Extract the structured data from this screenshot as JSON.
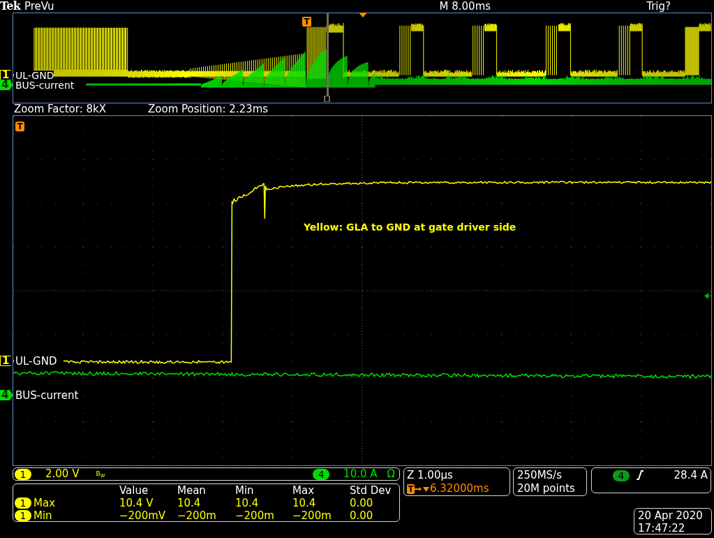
{
  "header": {
    "brand": "Tek",
    "mode": "PreVu",
    "timebase": "M 8.00ms",
    "trigger_status": "Trig?"
  },
  "overview": {
    "trigger_marker": "T",
    "channels": [
      {
        "number": "1",
        "label": "UL-GND",
        "color": "#ffff00",
        "kind": "outline"
      },
      {
        "number": "4",
        "label": "BUS-current",
        "color": "#00dd00",
        "kind": "filled"
      }
    ]
  },
  "zoom_info": {
    "factor": "Zoom Factor: 8kX",
    "position": "Zoom Position: 2.23ms"
  },
  "main": {
    "trigger_marker": "T",
    "annotation": "Yellow: GLA to GND at gate driver side",
    "channels": [
      {
        "number": "1",
        "label": "UL-GND",
        "color": "#ffff00",
        "kind": "outline"
      },
      {
        "number": "4",
        "label": "BUS-current",
        "color": "#00dd00",
        "kind": "filled"
      }
    ]
  },
  "vertical": [
    {
      "number": "1",
      "scale": "2.00 V",
      "extra": "B$_{W}$",
      "color": "#ffff00"
    },
    {
      "number": "4",
      "scale": "10.0 A",
      "extra": "Ω",
      "color": "#00dd00"
    }
  ],
  "measurements": {
    "columns": [
      "Value",
      "Mean",
      "Min",
      "Max",
      "Std Dev"
    ],
    "rows": [
      {
        "channel": "1",
        "name": "Max",
        "values": [
          "10.4 V",
          "10.4",
          "10.4",
          "10.4",
          "0.00"
        ]
      },
      {
        "channel": "1",
        "name": "Min",
        "values": [
          "−200mV",
          "−200m",
          "−200m",
          "−200m",
          "0.00"
        ]
      }
    ]
  },
  "horizontal": {
    "zoom_scale": "Z 1.00µs",
    "marker": "T",
    "trigger_position": "6.32000ms"
  },
  "acquisition": {
    "sample_rate": "250MS/s",
    "record_length": "20M points"
  },
  "trigger": {
    "source": "4",
    "level": "28.4 A"
  },
  "datetime": {
    "date": "20 Apr 2020",
    "time": "17:47:22"
  }
}
